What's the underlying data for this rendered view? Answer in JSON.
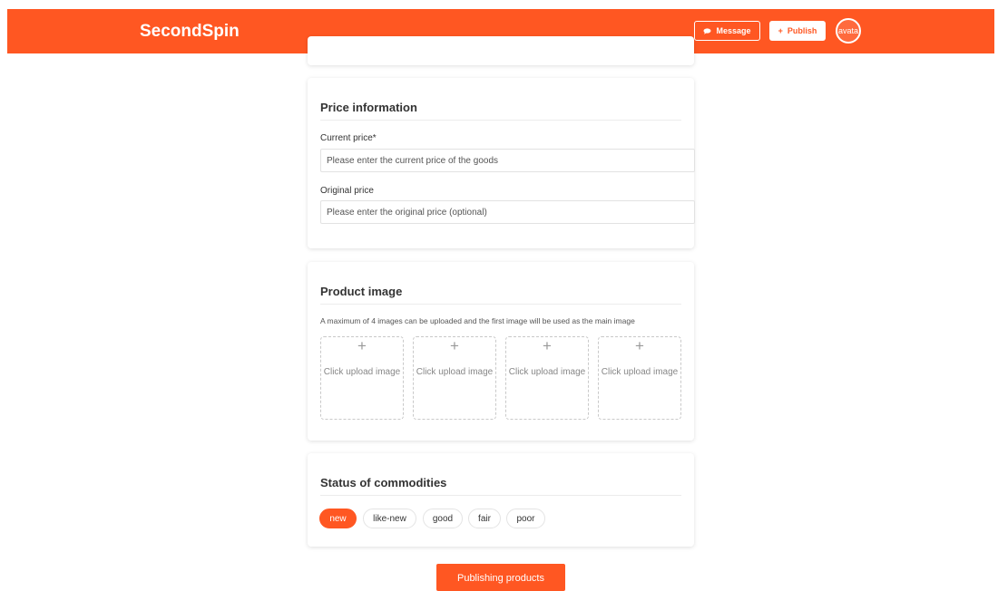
{
  "header": {
    "logo": "SecondSpin",
    "message_label": "Message",
    "message_icon": "chat-bubble-icon",
    "publish_label": "Publish",
    "publish_icon": "plus-icon",
    "avatar_alt": "avata",
    "brand_color": "#ff5722"
  },
  "price": {
    "title": "Price information",
    "current_label": "Current price*",
    "current_placeholder": "Please enter the current price of the goods",
    "original_label": "Original price",
    "original_placeholder": "Please enter the original price (optional)"
  },
  "images": {
    "title": "Product image",
    "hint": "A maximum of 4 images can be uploaded and the first image will be used as the main image",
    "slots": [
      {
        "plus": "+",
        "label": "Click upload image"
      },
      {
        "plus": "+",
        "label": "Click upload image"
      },
      {
        "plus": "+",
        "label": "Click upload image"
      },
      {
        "plus": "+",
        "label": "Click upload image"
      }
    ]
  },
  "status": {
    "title": "Status of commodities",
    "options": [
      "new",
      "like-new",
      "good",
      "fair",
      "poor"
    ],
    "selected": "new"
  },
  "submit_label": "Publishing products"
}
